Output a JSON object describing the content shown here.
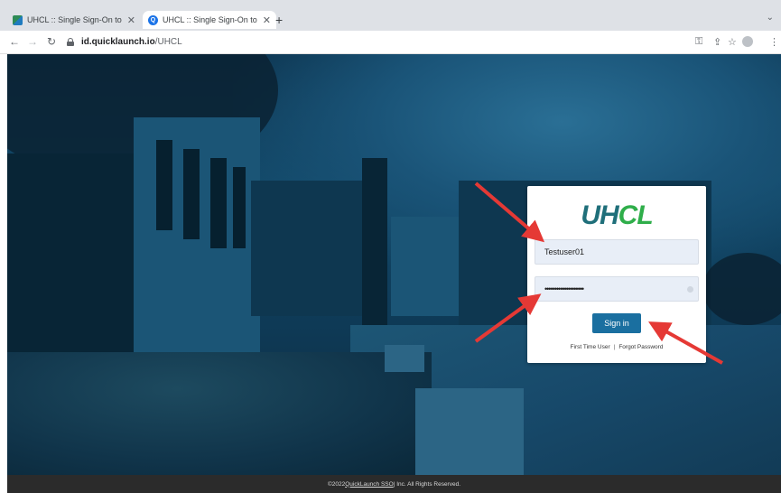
{
  "browser": {
    "tabs": [
      {
        "title": "UHCL :: Single Sign-On to all y",
        "close": "✕"
      },
      {
        "title": "UHCL :: Single Sign-On to all y",
        "close": "✕"
      }
    ],
    "new_tab": "+",
    "url_host": "id.quicklaunch.io",
    "url_path": "/UHCL"
  },
  "login": {
    "logo_uh": "UH",
    "logo_cl": "CL",
    "username_value": "Testuser01",
    "password_value": "••••••••••••••••••••",
    "signin_label": "Sign in",
    "first_time_user": "First Time User",
    "separator": "|",
    "forgot_password": "Forgot Password"
  },
  "footer": {
    "prefix": "©2022 ",
    "link": "QuickLaunch SSO",
    "suffix": " | Inc. All Rights Reserved."
  },
  "colors": {
    "arrow": "#e53935",
    "signin_button": "#1a6fa0",
    "logo_uh": "#1f6f7a",
    "logo_cl": "#2fae4a"
  },
  "icons": [
    "back-icon",
    "forward-icon",
    "reload-icon",
    "lock-icon",
    "key-icon",
    "share-icon",
    "star-icon",
    "profile-icon",
    "menu-icon"
  ]
}
